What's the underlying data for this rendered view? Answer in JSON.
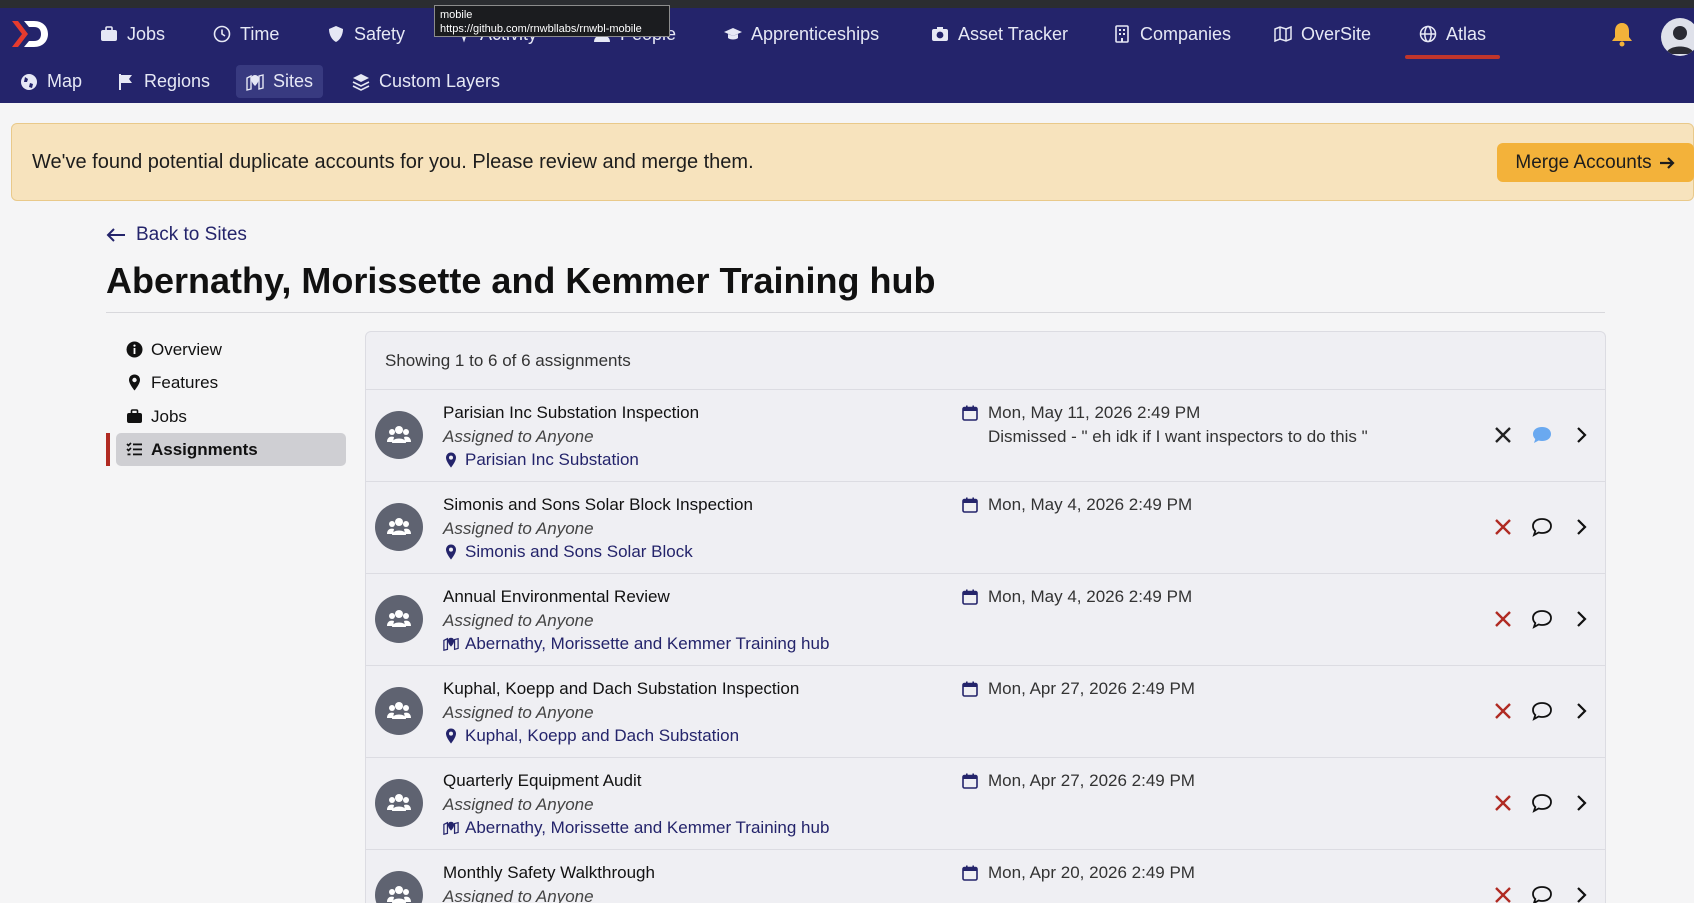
{
  "browser": {
    "tooltip": {
      "line1": "mobile",
      "line2": "https://github.com/rnwbllabs/rnwbl-mobile"
    }
  },
  "topnav": {
    "logo_icon": "rnwbl-logo-icon",
    "items": [
      {
        "label": "Jobs",
        "icon": "briefcase-icon"
      },
      {
        "label": "Time",
        "icon": "clock-icon"
      },
      {
        "label": "Safety",
        "icon": "shield-icon"
      },
      {
        "label": "Activity",
        "icon": "activity-icon"
      },
      {
        "label": "People",
        "icon": "person-icon"
      },
      {
        "label": "Apprenticeships",
        "icon": "graduation-cap-icon"
      },
      {
        "label": "Asset Tracker",
        "icon": "camera-icon"
      },
      {
        "label": "Companies",
        "icon": "building-icon"
      },
      {
        "label": "OverSite",
        "icon": "map-icon"
      },
      {
        "label": "Atlas",
        "icon": "globe-icon",
        "active": true
      }
    ]
  },
  "subnav": {
    "items": [
      {
        "label": "Map",
        "icon": "globe-icon"
      },
      {
        "label": "Regions",
        "icon": "flag-icon"
      },
      {
        "label": "Sites",
        "icon": "map-pin-icon",
        "active": true
      },
      {
        "label": "Custom Layers",
        "icon": "layers-icon"
      }
    ]
  },
  "banner": {
    "message": "We've found potential duplicate accounts for you. Please review and merge them.",
    "button_label": "Merge Accounts"
  },
  "page": {
    "back_label": "Back to Sites",
    "title": "Abernathy, Morissette and Kemmer Training hub"
  },
  "sidenav": {
    "items": [
      {
        "label": "Overview",
        "icon": "info-icon"
      },
      {
        "label": "Features",
        "icon": "map-marker-icon"
      },
      {
        "label": "Jobs",
        "icon": "briefcase-icon"
      },
      {
        "label": "Assignments",
        "icon": "list-check-icon",
        "active": true
      }
    ]
  },
  "assignments": {
    "summary": "Showing 1 to 6 of 6 assignments",
    "rows": [
      {
        "title": "Parisian Inc Substation Inspection",
        "assigned": "Assigned to Anyone",
        "location": "Parisian Inc Substation",
        "location_icon": "map-marker-icon",
        "date": "Mon, May 11, 2026 2:49 PM",
        "note": "Dismissed - \" eh idk if I want inspectors to do this \"",
        "dismissed": true
      },
      {
        "title": "Simonis and Sons Solar Block Inspection",
        "assigned": "Assigned to Anyone",
        "location": "Simonis and Sons Solar Block",
        "location_icon": "map-marker-icon",
        "date": "Mon, May 4, 2026 2:49 PM",
        "note": ""
      },
      {
        "title": "Annual Environmental Review",
        "assigned": "Assigned to Anyone",
        "location": "Abernathy, Morissette and Kemmer Training hub",
        "location_icon": "map-pin-icon",
        "date": "Mon, May 4, 2026 2:49 PM",
        "note": ""
      },
      {
        "title": "Kuphal, Koepp and Dach Substation Inspection",
        "assigned": "Assigned to Anyone",
        "location": "Kuphal, Koepp and Dach Substation",
        "location_icon": "map-marker-icon",
        "date": "Mon, Apr 27, 2026 2:49 PM",
        "note": ""
      },
      {
        "title": "Quarterly Equipment Audit",
        "assigned": "Assigned to Anyone",
        "location": "Abernathy, Morissette and Kemmer Training hub",
        "location_icon": "map-pin-icon",
        "date": "Mon, Apr 27, 2026 2:49 PM",
        "note": ""
      },
      {
        "title": "Monthly Safety Walkthrough",
        "assigned": "Assigned to Anyone",
        "location": "",
        "location_icon": "map-pin-icon",
        "date": "Mon, Apr 20, 2026 2:49 PM",
        "note": ""
      }
    ]
  },
  "colors": {
    "nav_bg": "#24246b",
    "accent_red": "#b02a22",
    "banner_bg": "#f7e3bd",
    "merge_button": "#f3b23a",
    "link": "#24246b"
  }
}
